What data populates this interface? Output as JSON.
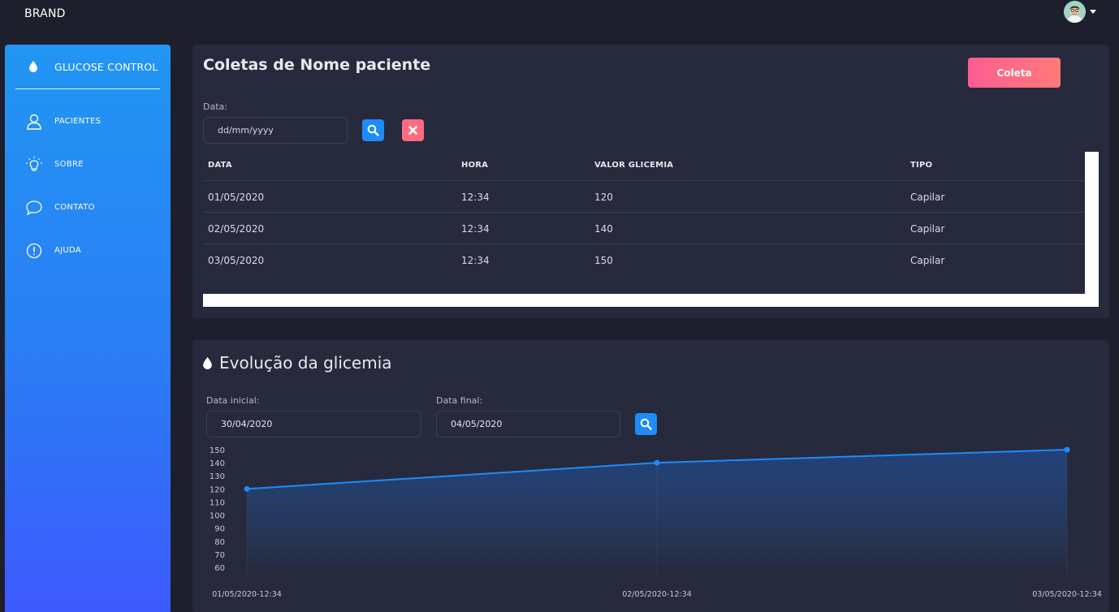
{
  "brand": "BRAND",
  "sidebar": {
    "title": "GLUCOSE CONTROL",
    "items": [
      {
        "label": "PACIENTES",
        "icon": "user-icon"
      },
      {
        "label": "SOBRE",
        "icon": "lightbulb-icon"
      },
      {
        "label": "CONTATO",
        "icon": "chat-icon"
      },
      {
        "label": "AJUDA",
        "icon": "info-icon"
      }
    ]
  },
  "coletas": {
    "title": "Coletas de Nome paciente",
    "button_label": "Coleta",
    "date_label": "Data:",
    "date_placeholder": "dd/mm/yyyy",
    "columns": [
      "DATA",
      "HORA",
      "VALOR GLICEMIA",
      "TIPO"
    ],
    "rows": [
      {
        "data": "01/05/2020",
        "hora": "12:34",
        "valor": "120",
        "tipo": "Capilar"
      },
      {
        "data": "02/05/2020",
        "hora": "12:34",
        "valor": "140",
        "tipo": "Capilar"
      },
      {
        "data": "03/05/2020",
        "hora": "12:34",
        "valor": "150",
        "tipo": "Capilar"
      }
    ]
  },
  "evolucao": {
    "title": "Evolução da glicemia",
    "start_label": "Data inicial:",
    "start_value": "30/04/2020",
    "end_label": "Data final:",
    "end_value": "04/05/2020"
  },
  "chart_data": {
    "type": "area",
    "title": "",
    "xlabel": "",
    "ylabel": "",
    "x": [
      "01/05/2020-12:34",
      "02/05/2020-12:34",
      "03/05/2020-12:34"
    ],
    "series": [
      {
        "values": [
          120,
          140,
          150
        ]
      }
    ],
    "y_ticks": [
      150,
      140,
      130,
      120,
      110,
      100,
      90,
      80,
      70,
      60
    ],
    "ylim": [
      60,
      150
    ],
    "grid": false,
    "line_color": "#1d8cf8"
  },
  "colors": {
    "background": "#1e1f2c",
    "card": "#27293d",
    "accent_blue": "#1d8cf8",
    "accent_pink": "#fd5d93"
  }
}
